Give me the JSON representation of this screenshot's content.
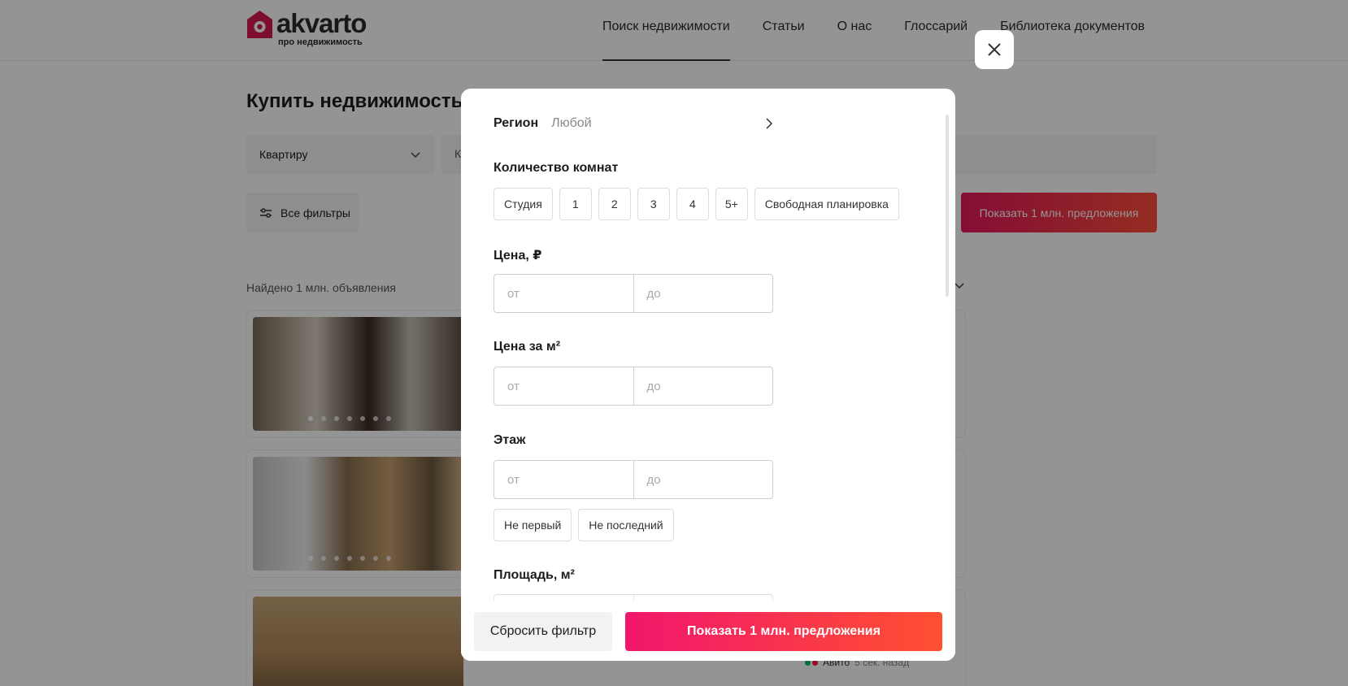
{
  "header": {
    "logo_word": "akvarto",
    "logo_sub": "про недвижимость",
    "nav": [
      {
        "label": "Поиск недвижимости"
      },
      {
        "label": "Статьи"
      },
      {
        "label": "О нас"
      },
      {
        "label": "Глоссарий"
      },
      {
        "label": "Библиотека документов"
      }
    ]
  },
  "main": {
    "title": "Купить недвижимость",
    "type_select": "Квартиру",
    "second_select": "К",
    "all_filters": "Все фильтры",
    "show_offers": "Показать 1 млн. предложения",
    "found": "Найдено 1 млн. объявления",
    "source_name": "Авито",
    "source_time": "5 сек. назад"
  },
  "modal": {
    "region_label": "Регион",
    "region_value": "Любой",
    "rooms_title": "Количество комнат",
    "rooms": [
      "Студия",
      "1",
      "2",
      "3",
      "4",
      "5+",
      "Свободная планировка"
    ],
    "price_title": "Цена, ₽",
    "price_sqm_title": "Цена за м²",
    "floor_title": "Этаж",
    "floor_options": [
      "Не первый",
      "Не последний"
    ],
    "area_title": "Площадь, м²",
    "from_placeholder": "от",
    "to_placeholder": "до",
    "reset_label": "Сбросить фильтр",
    "show_label": "Показать 1 млн. предложения"
  },
  "colors": {
    "accent_start": "#f2166d",
    "accent_end": "#ff5030",
    "overlay": "rgba(0,0,0,0.42)"
  }
}
